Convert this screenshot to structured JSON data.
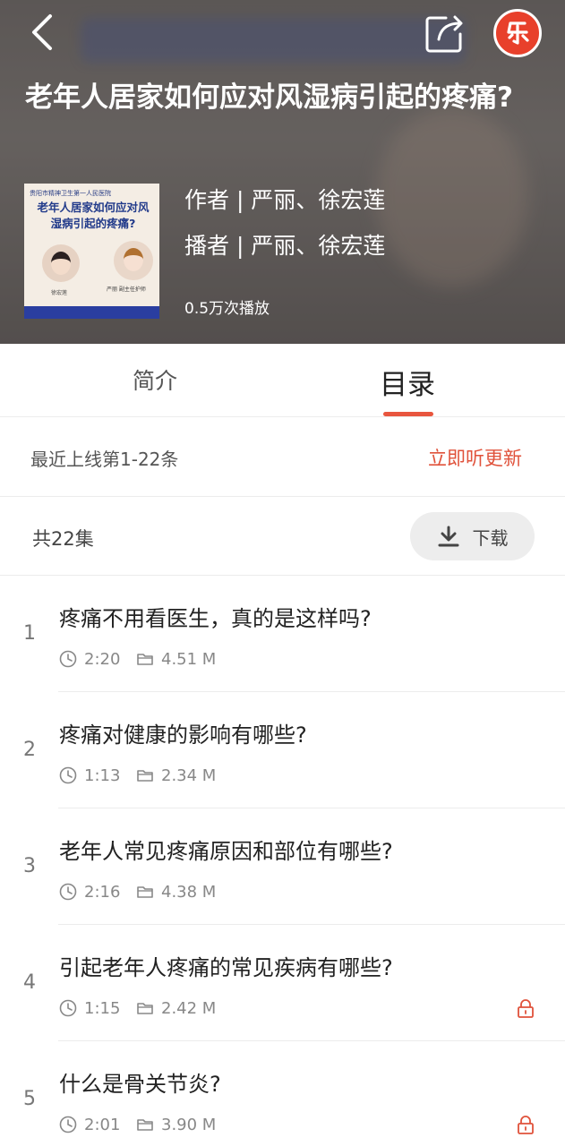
{
  "header": {
    "title": "老年人居家如何应对风湿病引起的疼痛?",
    "author": "作者 | 严丽、徐宏莲",
    "narrator": "播者 | 严丽、徐宏莲",
    "plays": "0.5万次播放",
    "brand_glyph": "乐",
    "back_icon": "chevron-left-icon",
    "share_icon": "share-icon"
  },
  "cover": {
    "org": "贵阳市精神卫生第一人民医院",
    "title": "老年人居家如何应对风湿病引起的疼痛?",
    "name1": "徐宏莲",
    "name2": "严丽 副主任护师"
  },
  "tabs": [
    {
      "label": "简介",
      "active": false
    },
    {
      "label": "目录",
      "active": true
    }
  ],
  "update": {
    "text": "最近上线第1-22条",
    "link": "立即听更新"
  },
  "count": {
    "text": "共22集",
    "download_label": "下载"
  },
  "episodes": [
    {
      "num": "1",
      "title": "疼痛不用看医生，真的是这样吗?",
      "duration": "2:20",
      "size": "4.51 M",
      "locked": false
    },
    {
      "num": "2",
      "title": "疼痛对健康的影响有哪些?",
      "duration": "1:13",
      "size": "2.34 M",
      "locked": false
    },
    {
      "num": "3",
      "title": "老年人常见疼痛原因和部位有哪些?",
      "duration": "2:16",
      "size": "4.38 M",
      "locked": false
    },
    {
      "num": "4",
      "title": "引起老年人疼痛的常见疾病有哪些?",
      "duration": "1:15",
      "size": "2.42 M",
      "locked": true
    },
    {
      "num": "5",
      "title": "什么是骨关节炎?",
      "duration": "2:01",
      "size": "3.90 M",
      "locked": true
    }
  ],
  "colors": {
    "accent": "#e0523b",
    "brand": "#e8402b",
    "tab_indicator": "#e8553e"
  }
}
